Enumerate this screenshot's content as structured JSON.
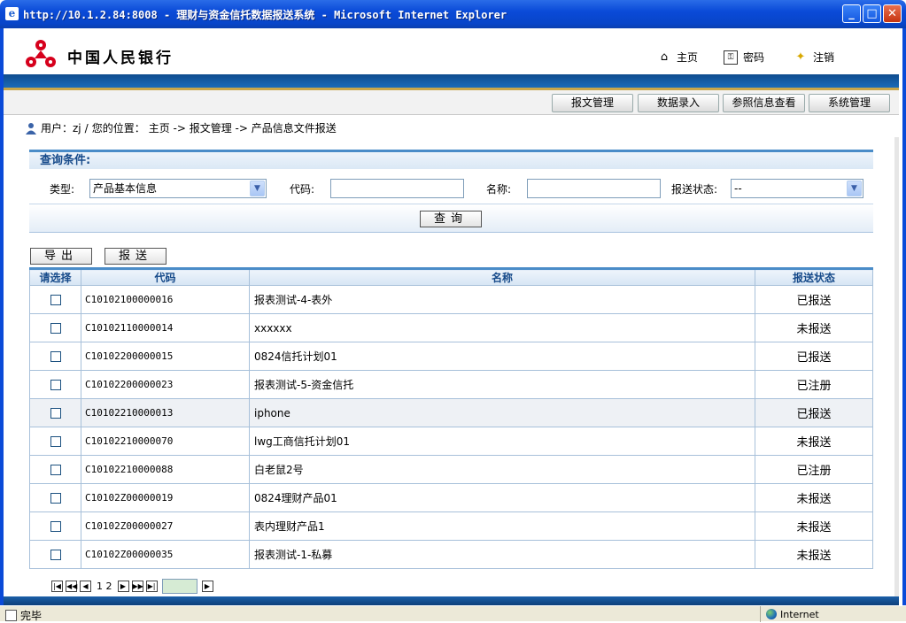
{
  "window": {
    "title": "http://10.1.2.84:8008 - 理财与资金信托数据报送系统 - Microsoft Internet Explorer"
  },
  "header": {
    "logo_text": "中国人民银行",
    "links": [
      {
        "label": "主页",
        "icon": "home-icon"
      },
      {
        "label": "密码",
        "icon": "key-icon"
      },
      {
        "label": "注销",
        "icon": "logout-icon"
      }
    ]
  },
  "nav": {
    "items": [
      "报文管理",
      "数据录入",
      "参照信息查看",
      "系统管理"
    ]
  },
  "breadcrumb": {
    "user_label": "用户：zj",
    "sep": "/",
    "location_label": "您的位置：",
    "path": "主页 -> 报文管理 -> 产品信息文件报送"
  },
  "query": {
    "title": "查询条件:",
    "type_label": "类型:",
    "type_value": "产品基本信息",
    "code_label": "代码:",
    "code_value": "",
    "name_label": "名称:",
    "name_value": "",
    "status_label": "报送状态:",
    "status_value": "--",
    "search_button": "查询"
  },
  "actions": {
    "export_button": "导出",
    "submit_button": "报送"
  },
  "table": {
    "headers": [
      "请选择",
      "代码",
      "名称",
      "报送状态"
    ],
    "rows": [
      {
        "code": "C10102100000016",
        "name": "报表测试-4-表外",
        "status": "已报送"
      },
      {
        "code": "C10102110000014",
        "name": "xxxxxx",
        "status": "未报送"
      },
      {
        "code": "C10102200000015",
        "name": "0824信托计划01",
        "status": "已报送"
      },
      {
        "code": "C10102200000023",
        "name": "报表测试-5-资金信托",
        "status": "已注册"
      },
      {
        "code": "C10102210000013",
        "name": "iphone",
        "status": "已报送"
      },
      {
        "code": "C10102210000070",
        "name": "lwg工商信托计划01",
        "status": "未报送"
      },
      {
        "code": "C10102210000088",
        "name": "白老鼠2号",
        "status": "已注册"
      },
      {
        "code": "C10102Z00000019",
        "name": "0824理财产品01",
        "status": "未报送"
      },
      {
        "code": "C10102Z00000027",
        "name": "表内理财产品1",
        "status": "未报送"
      },
      {
        "code": "C10102Z00000035",
        "name": "报表测试-1-私募",
        "status": "未报送"
      }
    ]
  },
  "pager": {
    "pages": "1 2",
    "page_input": ""
  },
  "statusbar": {
    "left": "完毕",
    "right": "Internet"
  },
  "colors": {
    "title_blue": "#0a4ad8",
    "header_band": "#1b6bb8",
    "accent_gold": "#c9a64a",
    "grid_border": "#a7c0da",
    "heading_text": "#164a8a"
  }
}
